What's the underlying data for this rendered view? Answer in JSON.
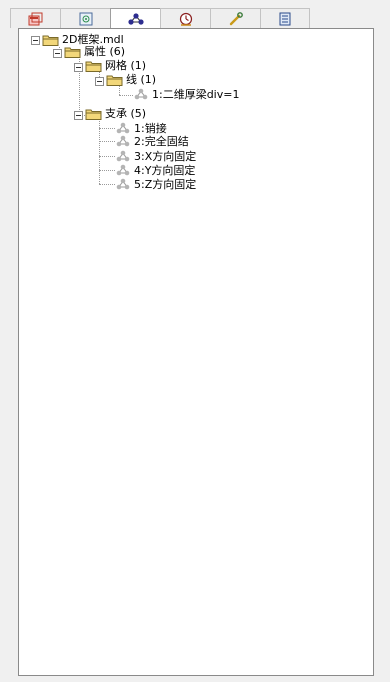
{
  "tabs": [
    {
      "name": "tab-model",
      "icon": "stacked-windows-icon",
      "active": false
    },
    {
      "name": "tab-view",
      "icon": "view-icon",
      "active": false
    },
    {
      "name": "tab-property-tree",
      "icon": "node-network-icon",
      "active": true
    },
    {
      "name": "tab-history",
      "icon": "clock-icon",
      "active": false
    },
    {
      "name": "tab-tools",
      "icon": "wrench-icon",
      "active": false
    },
    {
      "name": "tab-report",
      "icon": "document-icon",
      "active": false
    }
  ],
  "tree": {
    "root": {
      "label": "2D框架.mdl",
      "expanded": true
    },
    "properties": {
      "label": "属性 (6)",
      "expanded": true
    },
    "mesh": {
      "label": "网格 (1)",
      "expanded": true
    },
    "line": {
      "label": "线 (1)",
      "expanded": true
    },
    "line_item": {
      "label": "1:二维厚梁div=1"
    },
    "supports": {
      "label": "支承 (5)",
      "expanded": true
    },
    "support_items": [
      {
        "label": "1:销接"
      },
      {
        "label": "2:完全固结"
      },
      {
        "label": "3:X方向固定"
      },
      {
        "label": "4:Y方向固定"
      },
      {
        "label": "5:Z方向固定"
      }
    ]
  },
  "colors": {
    "folder_fill": "#f2d77a",
    "folder_stroke": "#7a6a2a",
    "leaf_icon": "#9a9a9a",
    "guide": "#9a9a9a"
  }
}
